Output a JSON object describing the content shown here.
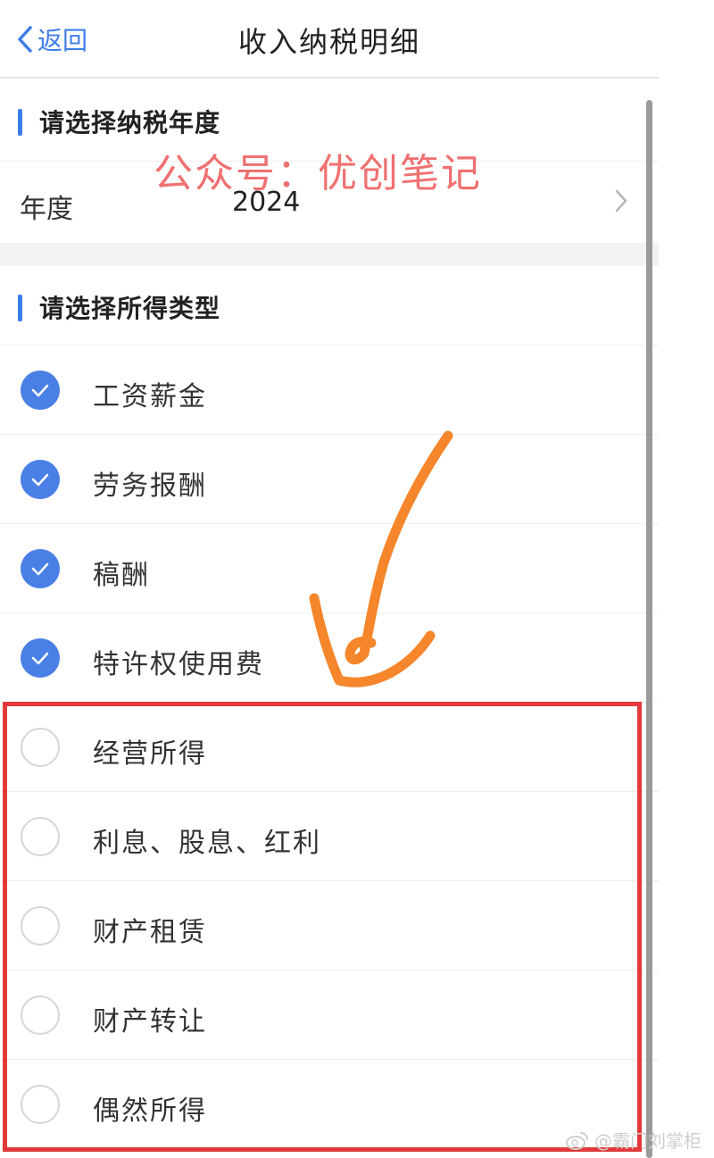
{
  "nav": {
    "back_label": "返回",
    "title": "收入纳税明细"
  },
  "watermark": "公众号：优创笔记",
  "sections": {
    "year_title": "请选择纳税年度",
    "type_title": "请选择所得类型"
  },
  "year_row": {
    "label": "年度",
    "value": "2024"
  },
  "income_types": [
    {
      "label": "工资薪金",
      "checked": true
    },
    {
      "label": "劳务报酬",
      "checked": true
    },
    {
      "label": "稿酬",
      "checked": true
    },
    {
      "label": "特许权使用费",
      "checked": true
    },
    {
      "label": "经营所得",
      "checked": false
    },
    {
      "label": "利息、股息、红利",
      "checked": false
    },
    {
      "label": "财产租赁",
      "checked": false
    },
    {
      "label": "财产转让",
      "checked": false
    },
    {
      "label": "偶然所得",
      "checked": false
    }
  ],
  "weibo_credit": "@霸门刘掌柜",
  "colors": {
    "accent": "#4a7fe5",
    "highlight_box": "#e23a3a",
    "annotation_arrow": "#f5862b",
    "watermark": "#f07070"
  }
}
